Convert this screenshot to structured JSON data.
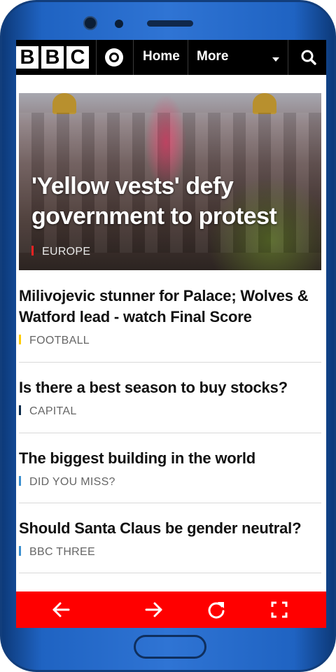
{
  "header": {
    "logo_letters": [
      "B",
      "B",
      "C"
    ],
    "nav_home": "Home",
    "nav_more": "More"
  },
  "hero": {
    "title": "'Yellow vests' defy government to protest",
    "tag": "EUROPE",
    "tag_color": "#ee2222"
  },
  "stories": [
    {
      "title": "Milivojevic stunner for Palace; Wolves & Watford lead - watch Final Score",
      "tag": "FOOTBALL",
      "tag_color": "#ffcc00"
    },
    {
      "title": "Is there a best season to buy stocks?",
      "tag": "CAPITAL",
      "tag_color": "#0a2a4a"
    },
    {
      "title": "The biggest building in the world",
      "tag": "DID YOU MISS?",
      "tag_color": "#3a8fd0"
    },
    {
      "title": "Should Santa Claus be gender neutral?",
      "tag": "BBC THREE",
      "tag_color": "#3a8fd0"
    }
  ],
  "toolbar": {
    "icons": [
      "arrow-left-icon",
      "arrow-right-icon",
      "refresh-icon",
      "fullscreen-icon"
    ],
    "color": "#ff0000"
  },
  "colors": {
    "header_bg": "#000000",
    "phone_frame": "#2f74d4"
  }
}
